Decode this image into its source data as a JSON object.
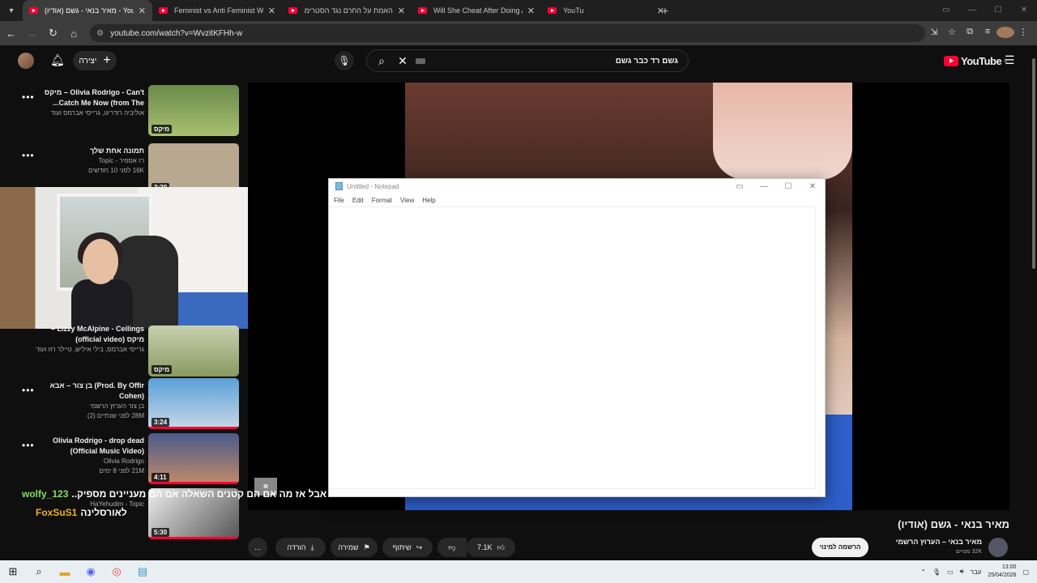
{
  "browser": {
    "tabs": [
      {
        "title": "מאיר בנאי - גשם (אודיו) - YouTube",
        "active": true
      },
      {
        "title": "Feminist vs Anti Feminist Wome",
        "active": false
      },
      {
        "title": "האמת על החרם נגד הסטרימר",
        "active": false
      },
      {
        "title": "Will She Cheat After Doing A S",
        "active": false
      },
      {
        "title": "YouTube",
        "active": false
      }
    ],
    "url": "youtube.com/watch?v=WvzitKFHh-w"
  },
  "youtube": {
    "create_label": "יצירה",
    "search_query": "גשם רד כבר גשם",
    "logo_text": "YouTube",
    "logo_region": "IL"
  },
  "recommendations": [
    {
      "title": "Olivia Rodrigo - Can't – מיקס Catch Me Now (from The...",
      "meta1": "אוליביה רודריגו, גרייסי אברמס ועוד",
      "meta2": "",
      "badge": "מיקס",
      "thumb_color": "#6a8a4a"
    },
    {
      "title": "תמונה אחת שלך",
      "meta1": "רז אספיר - Topic",
      "meta2": "16K  לפני 10 חודשים",
      "badge": "3:20",
      "thumb_color": "#b8a890"
    },
    {
      "title": "Lizzy McAlpine - Ceilings – מיקס (official video)",
      "meta1": "גרייסי אברמס, בילי איליש, טיילר רוז ועוד",
      "meta2": "",
      "badge": "מיקס",
      "thumb_color": "#9aa870"
    },
    {
      "title": "Prod. By Offir) בן צור – אבא (Cohen",
      "meta1": "בן צור הערוץ הרשמי",
      "meta2": "28M  לפני שנתיים (2)",
      "badge": "3:24",
      "thumb_color": "#4a90c8"
    },
    {
      "title": "Olivia Rodrigo - drop dead (Official Music Video)",
      "meta1": "Olivia Rodrigo",
      "meta2": "21M  לפני 8 ימים",
      "badge": "4:11",
      "thumb_color": "#8a5a6a"
    },
    {
      "title": "",
      "meta1": "HaYehudim - Topic",
      "meta2": "",
      "badge": "5:30",
      "thumb_color": "#3a3a3a"
    }
  ],
  "chat": [
    {
      "user": "wolfy_123",
      "message": "אבל אז מה אם הם קטנים השאלה אם הם מעניינים מספיק..",
      "user_color": "#7fe05a"
    },
    {
      "user": "FoxSuS1",
      "message": "לאורסלינה",
      "user_color": "#f0b020"
    }
  ],
  "notepad": {
    "title": "Untitled - Notepad",
    "menu": [
      "File",
      "Edit",
      "Format",
      "View",
      "Help"
    ],
    "content": ""
  },
  "video": {
    "title": "מאיר בנאי - גשם (אודיו)",
    "channel": "מאיר בנאי – הערוץ הרשמי",
    "subscribers": "32K מנויים",
    "subscribe_label": "הרשמה למינוי",
    "likes": "7.1K",
    "share_label": "שיתוף",
    "save_label": "שמירה",
    "download_label": "הורדה",
    "more_label": "..."
  },
  "taskbar": {
    "lang": "עבר",
    "time": "13:00",
    "date": "25/04/2026"
  }
}
